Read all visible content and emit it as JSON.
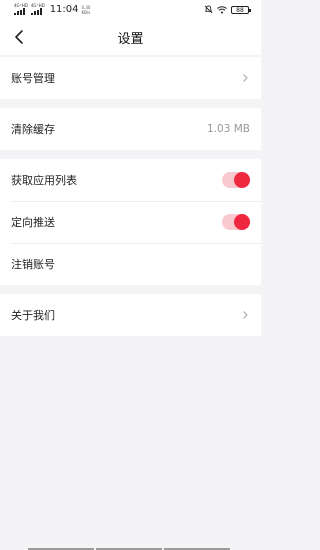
{
  "status": {
    "sim1": "4G⁺HD",
    "sim2": "4G⁺HD",
    "time": "11:04",
    "speed_value": "0.30",
    "speed_unit": "KB/s",
    "battery": "88"
  },
  "header": {
    "title": "设置"
  },
  "sections": [
    {
      "rows": [
        {
          "label": "账号管理"
        }
      ]
    },
    {
      "rows": [
        {
          "label": "清除缓存",
          "value": "1.03 MB"
        }
      ]
    },
    {
      "rows": [
        {
          "label": "获取应用列表",
          "toggle_on": true
        },
        {
          "label": "定向推送",
          "toggle_on": true
        },
        {
          "label": "注销账号"
        }
      ]
    },
    {
      "rows": [
        {
          "label": "关于我们"
        }
      ]
    }
  ],
  "colors": {
    "accent": "#f0283f",
    "track": "#f9c9d0",
    "background": "#f4f4f6"
  }
}
